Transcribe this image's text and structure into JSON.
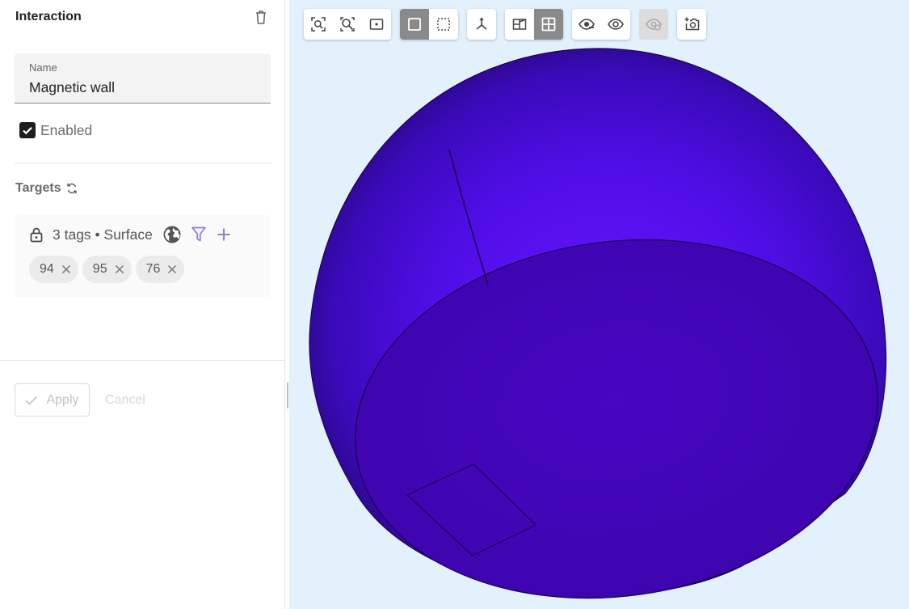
{
  "panel": {
    "title": "Interaction",
    "name_label": "Name",
    "name_value": "Magnetic wall",
    "enabled_label": "Enabled",
    "enabled_checked": true,
    "targets_label": "Targets",
    "tags_summary": "3 tags • Surface",
    "tags": [
      {
        "label": "94"
      },
      {
        "label": "95"
      },
      {
        "label": "76"
      }
    ],
    "apply_label": "Apply",
    "cancel_label": "Cancel",
    "accent_color": "#8a7fe8"
  },
  "viewport": {
    "background": "#e2f1fb",
    "model_color": "#4e0ee0",
    "toolbar_groups": [
      {
        "buttons": [
          {
            "icon": "zoom-fit-icon",
            "active": false
          },
          {
            "icon": "zoom-selection-icon",
            "active": false
          },
          {
            "icon": "zoom-region-icon",
            "active": false
          }
        ]
      },
      {
        "buttons": [
          {
            "icon": "solid-box-icon",
            "active": true
          },
          {
            "icon": "dashed-box-icon",
            "active": false
          }
        ]
      },
      {
        "buttons": [
          {
            "icon": "axes-icon",
            "active": false
          }
        ]
      },
      {
        "buttons": [
          {
            "icon": "perspective-view-icon",
            "active": false
          },
          {
            "icon": "quad-view-icon",
            "active": true
          }
        ]
      },
      {
        "buttons": [
          {
            "icon": "hide-eye-icon",
            "active": false
          },
          {
            "icon": "show-eye-icon",
            "active": false
          }
        ]
      },
      {
        "buttons": [
          {
            "icon": "visibility-settings-icon",
            "active": false
          }
        ],
        "disabled": true
      },
      {
        "buttons": [
          {
            "icon": "screenshot-icon",
            "active": false
          }
        ]
      }
    ]
  }
}
